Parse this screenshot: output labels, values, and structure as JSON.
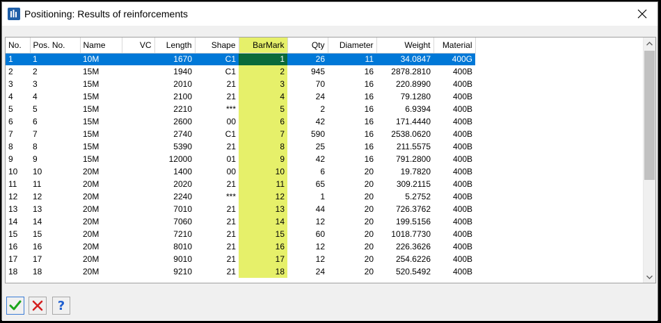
{
  "window": {
    "title": "Positioning: Results of reinforcements",
    "close_glyph": "✕",
    "icon": "app-icon"
  },
  "grid": {
    "columns": [
      {
        "key": "no",
        "label": "No.",
        "align": "l"
      },
      {
        "key": "pos",
        "label": "Pos. No.",
        "align": "l"
      },
      {
        "key": "name",
        "label": "Name",
        "align": "l"
      },
      {
        "key": "vc",
        "label": "VC",
        "align": "r"
      },
      {
        "key": "len",
        "label": "Length",
        "align": "r"
      },
      {
        "key": "shape",
        "label": "Shape",
        "align": "r"
      },
      {
        "key": "bar",
        "label": "BarMark",
        "align": "r"
      },
      {
        "key": "qty",
        "label": "Qty",
        "align": "r"
      },
      {
        "key": "dia",
        "label": "Diameter",
        "align": "r"
      },
      {
        "key": "wt",
        "label": "Weight",
        "align": "r"
      },
      {
        "key": "mat",
        "label": "Material",
        "align": "r"
      }
    ],
    "highlight_color": "#e6f06a",
    "selection_color": "#0078d7",
    "selected_row": 0,
    "rows": [
      [
        "1",
        "1",
        "10M",
        "",
        "1670",
        "C1",
        "1",
        "26",
        "11",
        "34.0847",
        "400G"
      ],
      [
        "2",
        "2",
        "15M",
        "",
        "1940",
        "C1",
        "2",
        "945",
        "16",
        "2878.2810",
        "400B"
      ],
      [
        "3",
        "3",
        "15M",
        "",
        "2010",
        "21",
        "3",
        "70",
        "16",
        "220.8990",
        "400B"
      ],
      [
        "4",
        "4",
        "15M",
        "",
        "2100",
        "21",
        "4",
        "24",
        "16",
        "79.1280",
        "400B"
      ],
      [
        "5",
        "5",
        "15M",
        "",
        "2210",
        "***",
        "5",
        "2",
        "16",
        "6.9394",
        "400B"
      ],
      [
        "6",
        "6",
        "15M",
        "",
        "2600",
        "00",
        "6",
        "42",
        "16",
        "171.4440",
        "400B"
      ],
      [
        "7",
        "7",
        "15M",
        "",
        "2740",
        "C1",
        "7",
        "590",
        "16",
        "2538.0620",
        "400B"
      ],
      [
        "8",
        "8",
        "15M",
        "",
        "5390",
        "21",
        "8",
        "25",
        "16",
        "211.5575",
        "400B"
      ],
      [
        "9",
        "9",
        "15M",
        "",
        "12000",
        "01",
        "9",
        "42",
        "16",
        "791.2800",
        "400B"
      ],
      [
        "10",
        "10",
        "20M",
        "",
        "1400",
        "00",
        "10",
        "6",
        "20",
        "19.7820",
        "400B"
      ],
      [
        "11",
        "11",
        "20M",
        "",
        "2020",
        "21",
        "11",
        "65",
        "20",
        "309.2115",
        "400B"
      ],
      [
        "12",
        "12",
        "20M",
        "",
        "2240",
        "***",
        "12",
        "1",
        "20",
        "5.2752",
        "400B"
      ],
      [
        "13",
        "13",
        "20M",
        "",
        "7010",
        "21",
        "13",
        "44",
        "20",
        "726.3762",
        "400B"
      ],
      [
        "14",
        "14",
        "20M",
        "",
        "7060",
        "21",
        "14",
        "12",
        "20",
        "199.5156",
        "400B"
      ],
      [
        "15",
        "15",
        "20M",
        "",
        "7210",
        "21",
        "15",
        "60",
        "20",
        "1018.7730",
        "400B"
      ],
      [
        "16",
        "16",
        "20M",
        "",
        "8010",
        "21",
        "16",
        "12",
        "20",
        "226.3626",
        "400B"
      ],
      [
        "17",
        "17",
        "20M",
        "",
        "9010",
        "21",
        "17",
        "12",
        "20",
        "254.6226",
        "400B"
      ],
      [
        "18",
        "18",
        "20M",
        "",
        "9210",
        "21",
        "18",
        "24",
        "20",
        "520.5492",
        "400B"
      ]
    ]
  },
  "buttons": {
    "ok_icon": "checkmark-icon",
    "cancel_icon": "cancel-icon",
    "help_icon": "help-icon",
    "help_glyph": "?"
  }
}
